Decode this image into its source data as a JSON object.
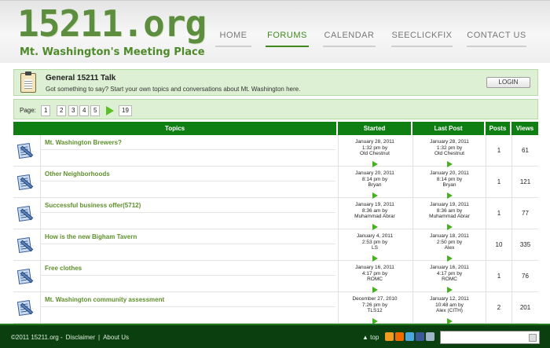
{
  "header": {
    "logo": "15211.org",
    "tagline": "Mt. Washington's Meeting Place",
    "nav": [
      "HOME",
      "FORUMS",
      "CALENDAR",
      "SEECLICKFIX",
      "CONTACT US"
    ],
    "active_nav": "FORUMS"
  },
  "forum": {
    "title": "General 15211 Talk",
    "description": "Got something to say? Start your own topics and conversations about Mt. Washington here.",
    "login_label": "LOGIN"
  },
  "pager": {
    "label": "Page:",
    "pages": [
      "1",
      "2",
      "3",
      "4",
      "5"
    ],
    "last": "19"
  },
  "table": {
    "headers": [
      "Topics",
      "Started",
      "Last Post",
      "Posts",
      "Views"
    ],
    "rows": [
      {
        "topic": "Mt. Washington Brewers?",
        "started": [
          "January 28, 2011",
          "1:32 pm by",
          "Old Chestnut"
        ],
        "last": [
          "January 28, 2011",
          "1:32 pm by",
          "Old Chestnut"
        ],
        "posts": "1",
        "views": "61"
      },
      {
        "topic": "Other Neighborhoods",
        "started": [
          "January 20, 2011",
          "8:14 pm by",
          "Bryan"
        ],
        "last": [
          "January 20, 2011",
          "8:14 pm by",
          "Bryan"
        ],
        "posts": "1",
        "views": "121"
      },
      {
        "topic": "Successful business offer(5712)",
        "started": [
          "January 19, 2011",
          "8:36 am by",
          "Muhammad Abrar"
        ],
        "last": [
          "January 19, 2011",
          "8:36 am by",
          "Muhammad Abrar"
        ],
        "posts": "1",
        "views": "77"
      },
      {
        "topic": "How is the new Bigham Tavern",
        "started": [
          "January 4, 2011",
          "2:53 pm by",
          "LS"
        ],
        "last": [
          "January 18, 2011",
          "2:50 pm by",
          "Alex"
        ],
        "posts": "10",
        "views": "335"
      },
      {
        "topic": "Free clothes",
        "started": [
          "January 16, 2011",
          "4:17 pm by",
          "ROMC"
        ],
        "last": [
          "January 16, 2011",
          "4:17 pm by",
          "ROMC"
        ],
        "posts": "1",
        "views": "76"
      },
      {
        "topic": "Mt. Washington community assessment",
        "started": [
          "December 27, 2010",
          "7:26 pm by",
          "TLS12"
        ],
        "last": [
          "January 12, 2011",
          "10:48 am by",
          "Alex (CITH)"
        ],
        "posts": "2",
        "views": "201"
      }
    ]
  },
  "footer": {
    "copyright": "©2011 15211.org -",
    "disclaimer": "Disclaimer",
    "separator": "|",
    "about": "About Us",
    "top": "top",
    "icons": [
      "rss-icon",
      "blogger-icon",
      "twitter-icon",
      "facebook-icon",
      "email-icon"
    ],
    "icon_colors": [
      "#f09a20",
      "#f06a00",
      "#4aa6dc",
      "#3b5998",
      "#9fb6c8"
    ]
  }
}
